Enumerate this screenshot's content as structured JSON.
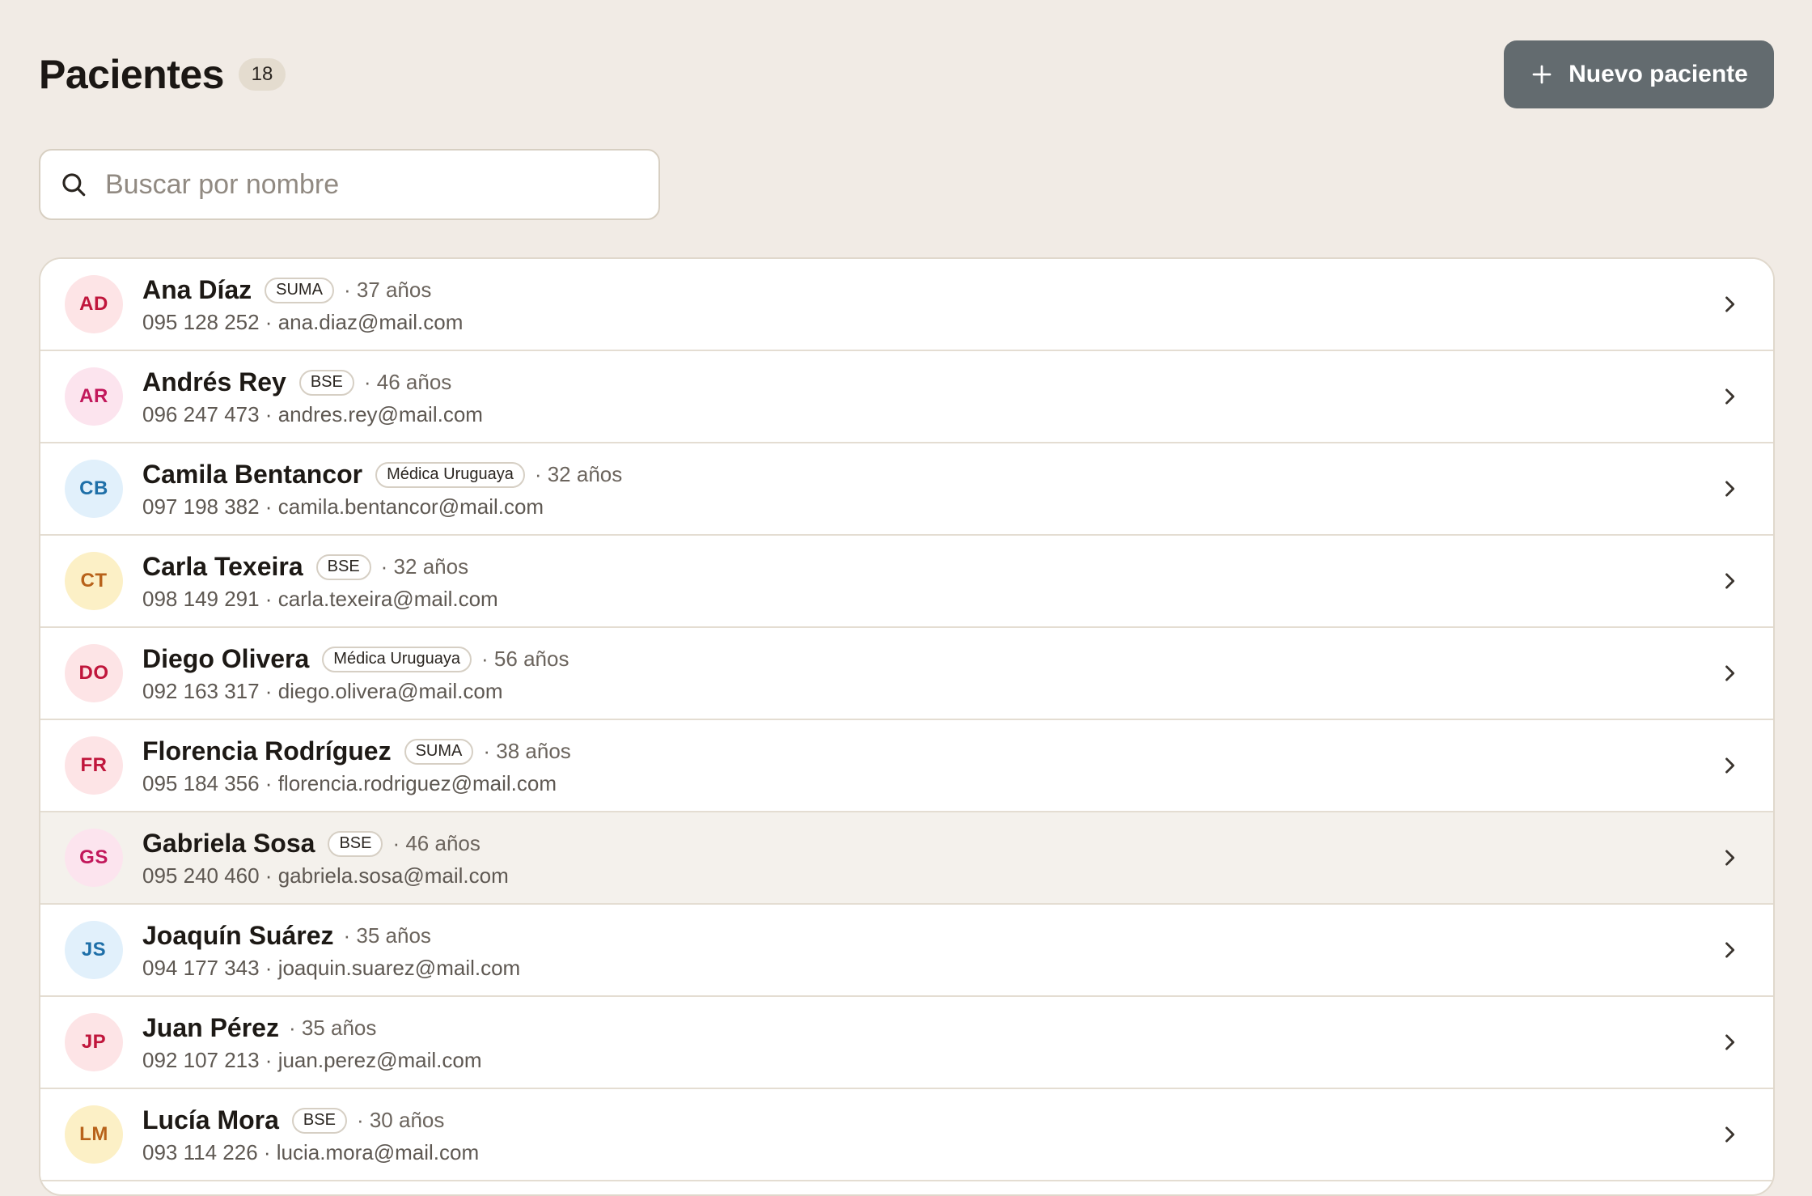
{
  "header": {
    "title": "Pacientes",
    "count": "18",
    "new_button_label": "Nuevo paciente"
  },
  "search": {
    "placeholder": "Buscar por nombre",
    "value": ""
  },
  "colors": {
    "background": "#f1ebe5",
    "primary_button": "#636b6f"
  },
  "icons": {
    "new_button": "plus-icon",
    "search": "search-icon",
    "row_action": "chevron-right-icon"
  },
  "patients": [
    {
      "initials": "AD",
      "name": "Ana Díaz",
      "plan": "SUMA",
      "age": "· 37 años",
      "contact": "095 128 252 · ana.diaz@mail.com",
      "avatar_style": "rose"
    },
    {
      "initials": "AR",
      "name": "Andrés Rey",
      "plan": "BSE",
      "age": "· 46 años",
      "contact": "096 247 473 · andres.rey@mail.com",
      "avatar_style": "pink"
    },
    {
      "initials": "CB",
      "name": "Camila Bentancor",
      "plan": "Médica Uruguaya",
      "age": "· 32 años",
      "contact": "097 198 382 · camila.bentancor@mail.com",
      "avatar_style": "blue"
    },
    {
      "initials": "CT",
      "name": "Carla Texeira",
      "plan": "BSE",
      "age": "· 32 años",
      "contact": "098 149 291 · carla.texeira@mail.com",
      "avatar_style": "amber"
    },
    {
      "initials": "DO",
      "name": "Diego Olivera",
      "plan": "Médica Uruguaya",
      "age": "· 56 años",
      "contact": "092 163 317 · diego.olivera@mail.com",
      "avatar_style": "rose"
    },
    {
      "initials": "FR",
      "name": "Florencia Rodríguez",
      "plan": "SUMA",
      "age": "· 38 años",
      "contact": "095 184 356 · florencia.rodriguez@mail.com",
      "avatar_style": "rose"
    },
    {
      "initials": "GS",
      "name": "Gabriela Sosa",
      "plan": "BSE",
      "age": "· 46 años",
      "contact": "095 240 460 · gabriela.sosa@mail.com",
      "avatar_style": "pink",
      "hover": true
    },
    {
      "initials": "JS",
      "name": "Joaquín Suárez",
      "plan": "",
      "age": "· 35 años",
      "contact": "094 177 343 · joaquin.suarez@mail.com",
      "avatar_style": "blue"
    },
    {
      "initials": "JP",
      "name": "Juan Pérez",
      "plan": "",
      "age": "· 35 años",
      "contact": "092 107 213 · juan.perez@mail.com",
      "avatar_style": "rose"
    },
    {
      "initials": "LM",
      "name": "Lucía Mora",
      "plan": "BSE",
      "age": "· 30 años",
      "contact": "093 114 226 · lucia.mora@mail.com",
      "avatar_style": "amber"
    }
  ]
}
